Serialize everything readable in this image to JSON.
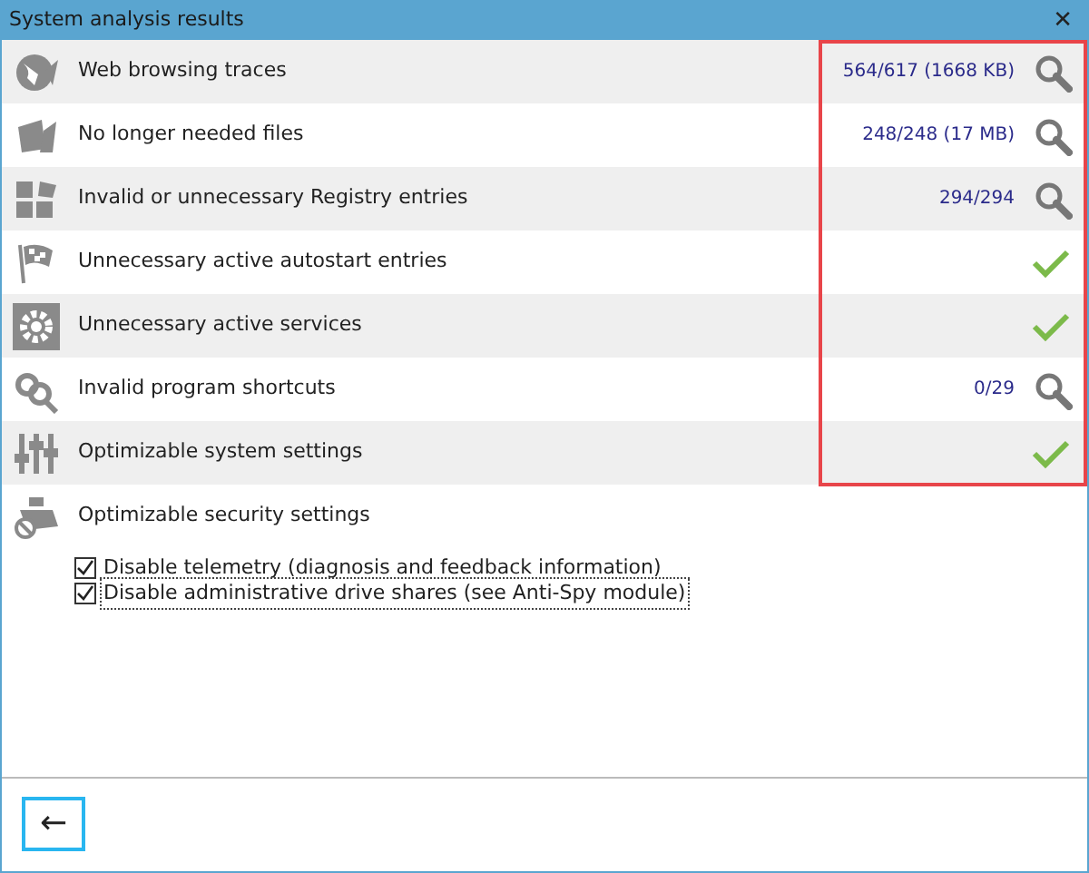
{
  "window": {
    "title": "System analysis results",
    "close": "✕"
  },
  "results": [
    {
      "label": "Web browsing traces",
      "kind": "count",
      "value": "564/617 (1668 KB)"
    },
    {
      "label": "No longer needed files",
      "kind": "count",
      "value": "248/248 (17 MB)"
    },
    {
      "label": "Invalid or unnecessary Registry entries",
      "kind": "count",
      "value": "294/294"
    },
    {
      "label": "Unnecessary active autostart entries",
      "kind": "ok"
    },
    {
      "label": "Unnecessary active services",
      "kind": "ok"
    },
    {
      "label": "Invalid program shortcuts",
      "kind": "count",
      "value": "0/29"
    },
    {
      "label": "Optimizable system settings",
      "kind": "ok"
    }
  ],
  "security": {
    "label": "Optimizable security settings",
    "options": [
      {
        "label": "Disable telemetry (diagnosis and feedback information)",
        "checked": true,
        "focused": false
      },
      {
        "label": "Disable administrative drive shares (see Anti-Spy module)",
        "checked": true,
        "focused": true
      }
    ]
  },
  "footer": {
    "back": "←"
  }
}
